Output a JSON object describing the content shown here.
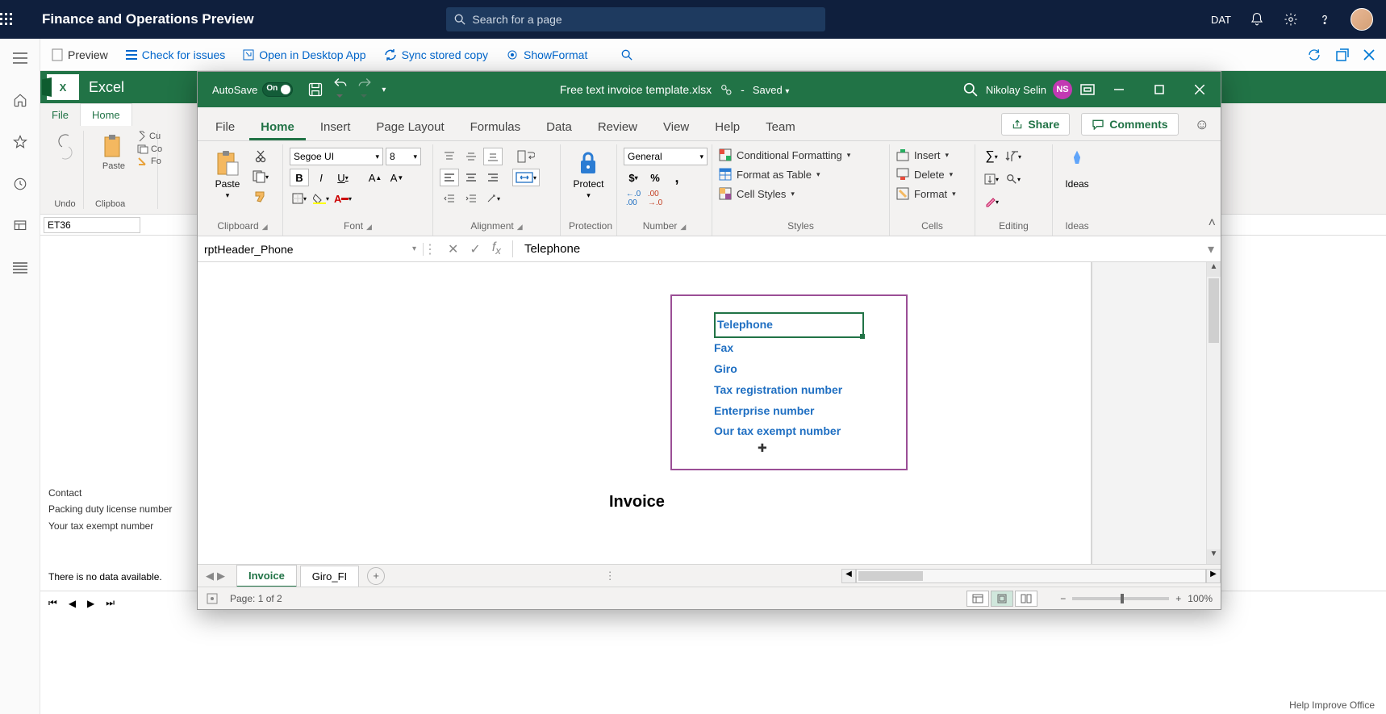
{
  "topbar": {
    "title": "Finance and Operations Preview",
    "search_placeholder": "Search for a page",
    "company": "DAT"
  },
  "cmdbar": {
    "preview": "Preview",
    "check": "Check for issues",
    "open_desktop": "Open in Desktop App",
    "sync": "Sync stored copy",
    "showformat": "ShowFormat"
  },
  "bg_excel": {
    "app": "Excel",
    "tabs": {
      "file": "File",
      "home": "Home"
    },
    "ribbon": {
      "undo": "Undo",
      "clipboard": "Clipboa"
    },
    "namebox": "ET36",
    "side": {
      "contact": "Contact",
      "packing": "Packing duty license number",
      "yourtax": "Your tax exempt number"
    },
    "nodata": "There is no data available."
  },
  "excel": {
    "autosave": "AutoSave",
    "autosave_state": "On",
    "filename": "Free text invoice template.xlsx",
    "saved": "Saved",
    "user_name": "Nikolay Selin",
    "user_initials": "NS",
    "tabs": {
      "file": "File",
      "home": "Home",
      "insert": "Insert",
      "page_layout": "Page Layout",
      "formulas": "Formulas",
      "data": "Data",
      "review": "Review",
      "view": "View",
      "help": "Help",
      "team": "Team"
    },
    "share": "Share",
    "comments": "Comments",
    "ribbon": {
      "paste": "Paste",
      "clipboard": "Clipboard",
      "font_name": "Segoe UI",
      "font_size": "8",
      "font_group": "Font",
      "alignment": "Alignment",
      "protect": "Protect",
      "protection": "Protection",
      "number_format": "General",
      "number": "Number",
      "cond_fmt": "Conditional Formatting",
      "fmt_table": "Format as Table",
      "cell_styles": "Cell Styles",
      "styles": "Styles",
      "insert": "Insert",
      "delete": "Delete",
      "format": "Format",
      "cells": "Cells",
      "editing": "Editing",
      "ideas": "Ideas"
    },
    "namebox": "rptHeader_Phone",
    "formula_value": "Telephone",
    "fields": {
      "telephone": "Telephone",
      "fax": "Fax",
      "giro": "Giro",
      "taxreg": "Tax registration number",
      "enterprise": "Enterprise number",
      "ourtax": "Our tax exempt number"
    },
    "invoice_heading": "Invoice",
    "sheets": {
      "invoice": "Invoice",
      "giro": "Giro_FI"
    },
    "status": {
      "page": "Page: 1 of 2",
      "zoom": "100%"
    }
  },
  "footer": {
    "help_improve": "Help Improve Office"
  }
}
